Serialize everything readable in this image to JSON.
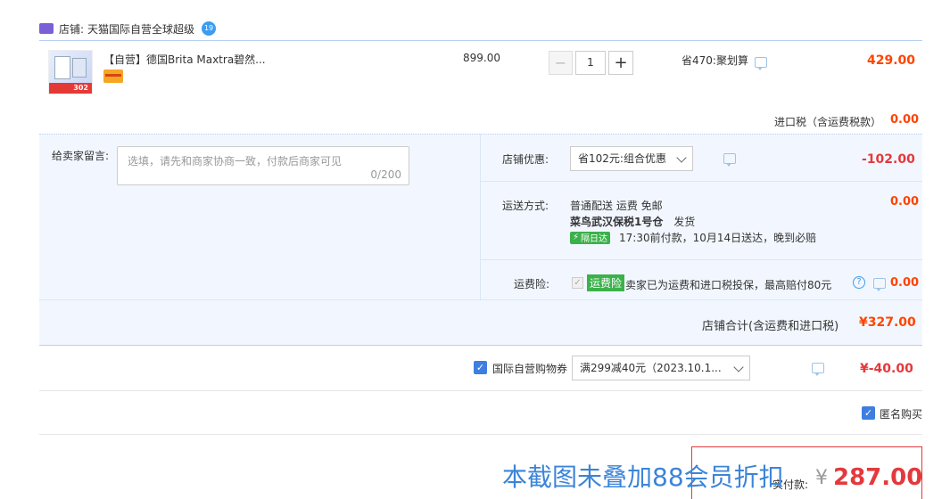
{
  "shop": {
    "label": "店铺:",
    "name": "天猫国际自营全球超级",
    "badge": "19"
  },
  "item": {
    "title": "【自营】德国Brita Maxtra碧然...",
    "thumb_price": "302",
    "unit_price": "899.00",
    "quantity": "1",
    "decrement": "−",
    "increment": "+",
    "saving": "省470:聚划算",
    "subtotal": "429.00"
  },
  "import_tax": {
    "label": "进口税（含运费税款）",
    "value": "0.00"
  },
  "message": {
    "label": "给卖家留言:",
    "placeholder": "选填，请先和商家协商一致，付款后商家可见",
    "counter": "0/200"
  },
  "discount": {
    "label": "店铺优惠:",
    "selected": "省102元:组合优惠",
    "value": "-102.00"
  },
  "shipping": {
    "label": "运送方式:",
    "method": "普通配送 运费 免邮",
    "warehouse": "菜鸟武汉保税1号仓",
    "dispatch": "发货",
    "tag": "隔日达",
    "eta": "17:30前付款，10月14日送达，晚到必赔",
    "value": "0.00"
  },
  "insurance": {
    "label": "运费险:",
    "tag": "运费险",
    "desc": "卖家已为运费和进口税投保，最高赔付80元",
    "value": "0.00"
  },
  "shop_total": {
    "label": "店铺合计(含运费和进口税)",
    "value": "¥327.00"
  },
  "coupon": {
    "label": "国际自营购物券",
    "selected": "满299减40元（2023.10.1...",
    "value": "¥-40.00"
  },
  "anonymous": {
    "label": "匿名购买"
  },
  "watermark": "本截图未叠加88会员折扣",
  "payment": {
    "label": "实付款:",
    "currency": "¥",
    "amount": "287.00"
  },
  "colors": {
    "accent": "#ff4400",
    "price_red": "#e4393c",
    "checkbox_blue": "#3d7ee0",
    "panel_bg": "#f2f7ff",
    "tag_green": "#3bb14a"
  }
}
